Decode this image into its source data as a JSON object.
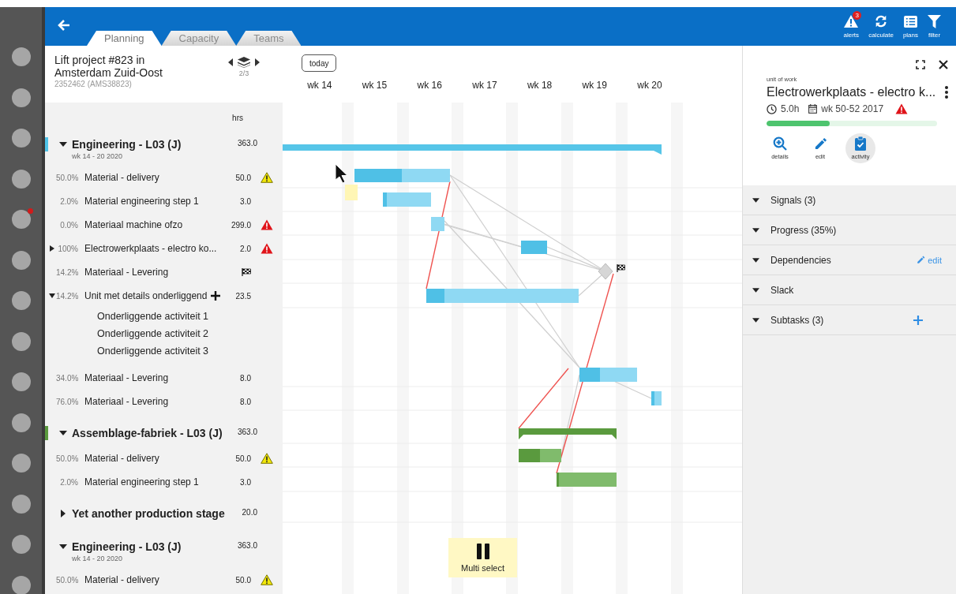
{
  "dock": [
    {
      "badge": false
    },
    {
      "badge": false
    },
    {
      "badge": false
    },
    {
      "badge": false
    },
    {
      "badge": true
    },
    {
      "badge": false
    },
    {
      "badge": false
    },
    {
      "badge": false
    },
    {
      "badge": false
    },
    {
      "badge": false
    },
    {
      "badge": false
    },
    {
      "badge": false
    },
    {
      "badge": false
    },
    {
      "badge": false
    }
  ],
  "topbar": {
    "tabs": [
      {
        "label": "Planning",
        "selected": true
      },
      {
        "label": "Capacity",
        "selected": false
      },
      {
        "label": "Teams",
        "selected": false
      }
    ],
    "actions": [
      {
        "kind": "alerts",
        "label": "alerts",
        "badge": "3"
      },
      {
        "kind": "calculate",
        "label": "calculate"
      },
      {
        "kind": "plans",
        "label": "plans"
      },
      {
        "kind": "filter",
        "label": "filter"
      }
    ]
  },
  "project": {
    "title": "Lift project #823 in Amsterdam Zuid-Oost",
    "code": "2352462 (AMS38823)",
    "page": "2/3"
  },
  "list": {
    "hours_header": "hrs",
    "rows": [
      {
        "kind": "group",
        "name": "Engineering - L03 (J)",
        "subtitle": "wk 14 - 20 2020",
        "hours": "363.0",
        "expanded": true,
        "color": "#4fc3e8"
      },
      {
        "kind": "task",
        "percent": "50.0%",
        "name": "Material - delivery",
        "hours": "50.0",
        "signal": {
          "kind": "warning"
        }
      },
      {
        "kind": "task",
        "percent": "2.0%",
        "name": "Material engineering step 1",
        "hours": "3.0"
      },
      {
        "kind": "task",
        "percent": "0.0%",
        "name": "Materiaal machine  ofzo",
        "hours": "299.0",
        "signal": {
          "kind": "error"
        }
      },
      {
        "kind": "task",
        "percent": "100%",
        "name": "Electrowerkplaats - electro ko...",
        "hours": "2.0",
        "signal": {
          "kind": "error"
        },
        "expanded": false
      },
      {
        "kind": "task",
        "percent": "14.2%",
        "name": "Materiaal - Levering",
        "signal": {
          "kind": "flag"
        }
      },
      {
        "kind": "task",
        "percent": "14.2%",
        "name": "Unit met details onderliggend",
        "hours": "23.5",
        "expanded": true,
        "addable": true,
        "children": [
          {
            "name": "Onderliggende activiteit 1"
          },
          {
            "name": "Onderliggende activiteit 2"
          },
          {
            "name": "Onderliggende activiteit 3"
          }
        ]
      },
      {
        "kind": "task",
        "percent": "34.0%",
        "name": "Materiaal - Levering",
        "hours": "8.0"
      },
      {
        "kind": "task",
        "percent": "76.0%",
        "name": "Materiaal - Levering",
        "hours": "8.0"
      },
      {
        "kind": "group",
        "name": "Assemblage-fabriek - L03 (J)",
        "hours": "363.0",
        "expanded": true,
        "color": "#5a9a3e"
      },
      {
        "kind": "task",
        "percent": "50.0%",
        "name": "Material - delivery",
        "hours": "50.0",
        "signal": {
          "kind": "warning"
        }
      },
      {
        "kind": "task",
        "percent": "2.0%",
        "name": "Material engineering step 1",
        "hours": "3.0"
      },
      {
        "kind": "group",
        "name": "Yet another production stage",
        "hours": "20.0",
        "expanded": false
      },
      {
        "kind": "group",
        "name": "Engineering - L03 (J)",
        "subtitle": "wk 14 - 20 2020",
        "hours": "363.0",
        "expanded": true
      },
      {
        "kind": "task",
        "percent": "50.0%",
        "name": "Material - delivery",
        "hours": "50.0",
        "signal": {
          "kind": "warning"
        }
      }
    ]
  },
  "timeline": {
    "today": "today",
    "weeks": [
      "wk 14",
      "wk 15",
      "wk 16",
      "wk 17",
      "wk 18",
      "wk 19",
      "wk 20"
    ],
    "multi_select": "Multi select"
  },
  "details": {
    "label": "unit of work",
    "title": "Electrowerkplaats - electro k...",
    "duration": "5.0h",
    "period": "wk 50-52 2017",
    "signal": {
      "kind": "error"
    },
    "progress": {
      "level": 0.37
    },
    "actions": [
      {
        "kind": "details",
        "label": "details",
        "selected": false
      },
      {
        "kind": "edit",
        "label": "edit",
        "selected": false
      },
      {
        "kind": "activity",
        "label": "activity",
        "selected": true
      }
    ],
    "sections": [
      {
        "label": "Signals (3)"
      },
      {
        "label": "Progress (35%)"
      },
      {
        "label": "Dependencies",
        "action": {
          "kind": "edit",
          "label": "edit"
        }
      },
      {
        "label": "Slack"
      },
      {
        "label": "Subtasks (3)",
        "action": {
          "kind": "add"
        }
      }
    ]
  }
}
